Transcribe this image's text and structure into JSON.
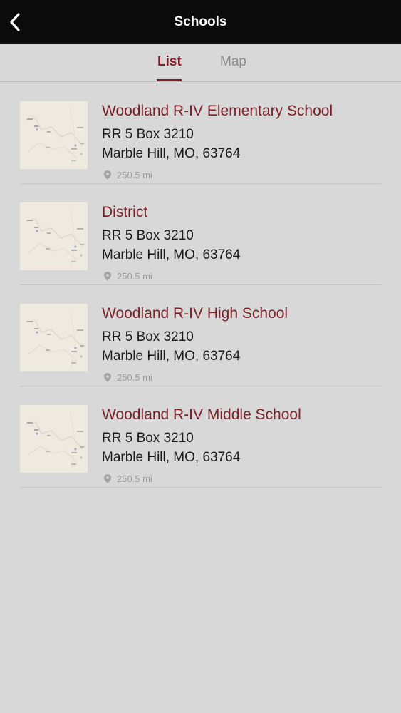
{
  "header": {
    "title": "Schools"
  },
  "tabs": {
    "list_label": "List",
    "map_label": "Map",
    "active": "List"
  },
  "schools": [
    {
      "name": "Woodland R-IV Elementary School",
      "address": "RR 5 Box 3210",
      "city": "Marble Hill, MO, 63764",
      "distance": "250.5 mi"
    },
    {
      "name": "District",
      "address": "RR 5 Box 3210",
      "city": "Marble Hill, MO, 63764",
      "distance": "250.5 mi"
    },
    {
      "name": "Woodland R-IV High School",
      "address": "RR 5 Box 3210",
      "city": "Marble Hill, MO, 63764",
      "distance": "250.5 mi"
    },
    {
      "name": "Woodland R-IV Middle School",
      "address": "RR 5 Box 3210",
      "city": "Marble Hill, MO, 63764",
      "distance": "250.5 mi"
    }
  ],
  "colors": {
    "accent": "#7a1f26",
    "header_bg": "#0b0b0b",
    "page_bg": "#d9d8d9"
  },
  "icons": {
    "back": "chevron-left-icon",
    "distance": "location-pin-icon",
    "thumbnail": "map-thumbnail"
  }
}
